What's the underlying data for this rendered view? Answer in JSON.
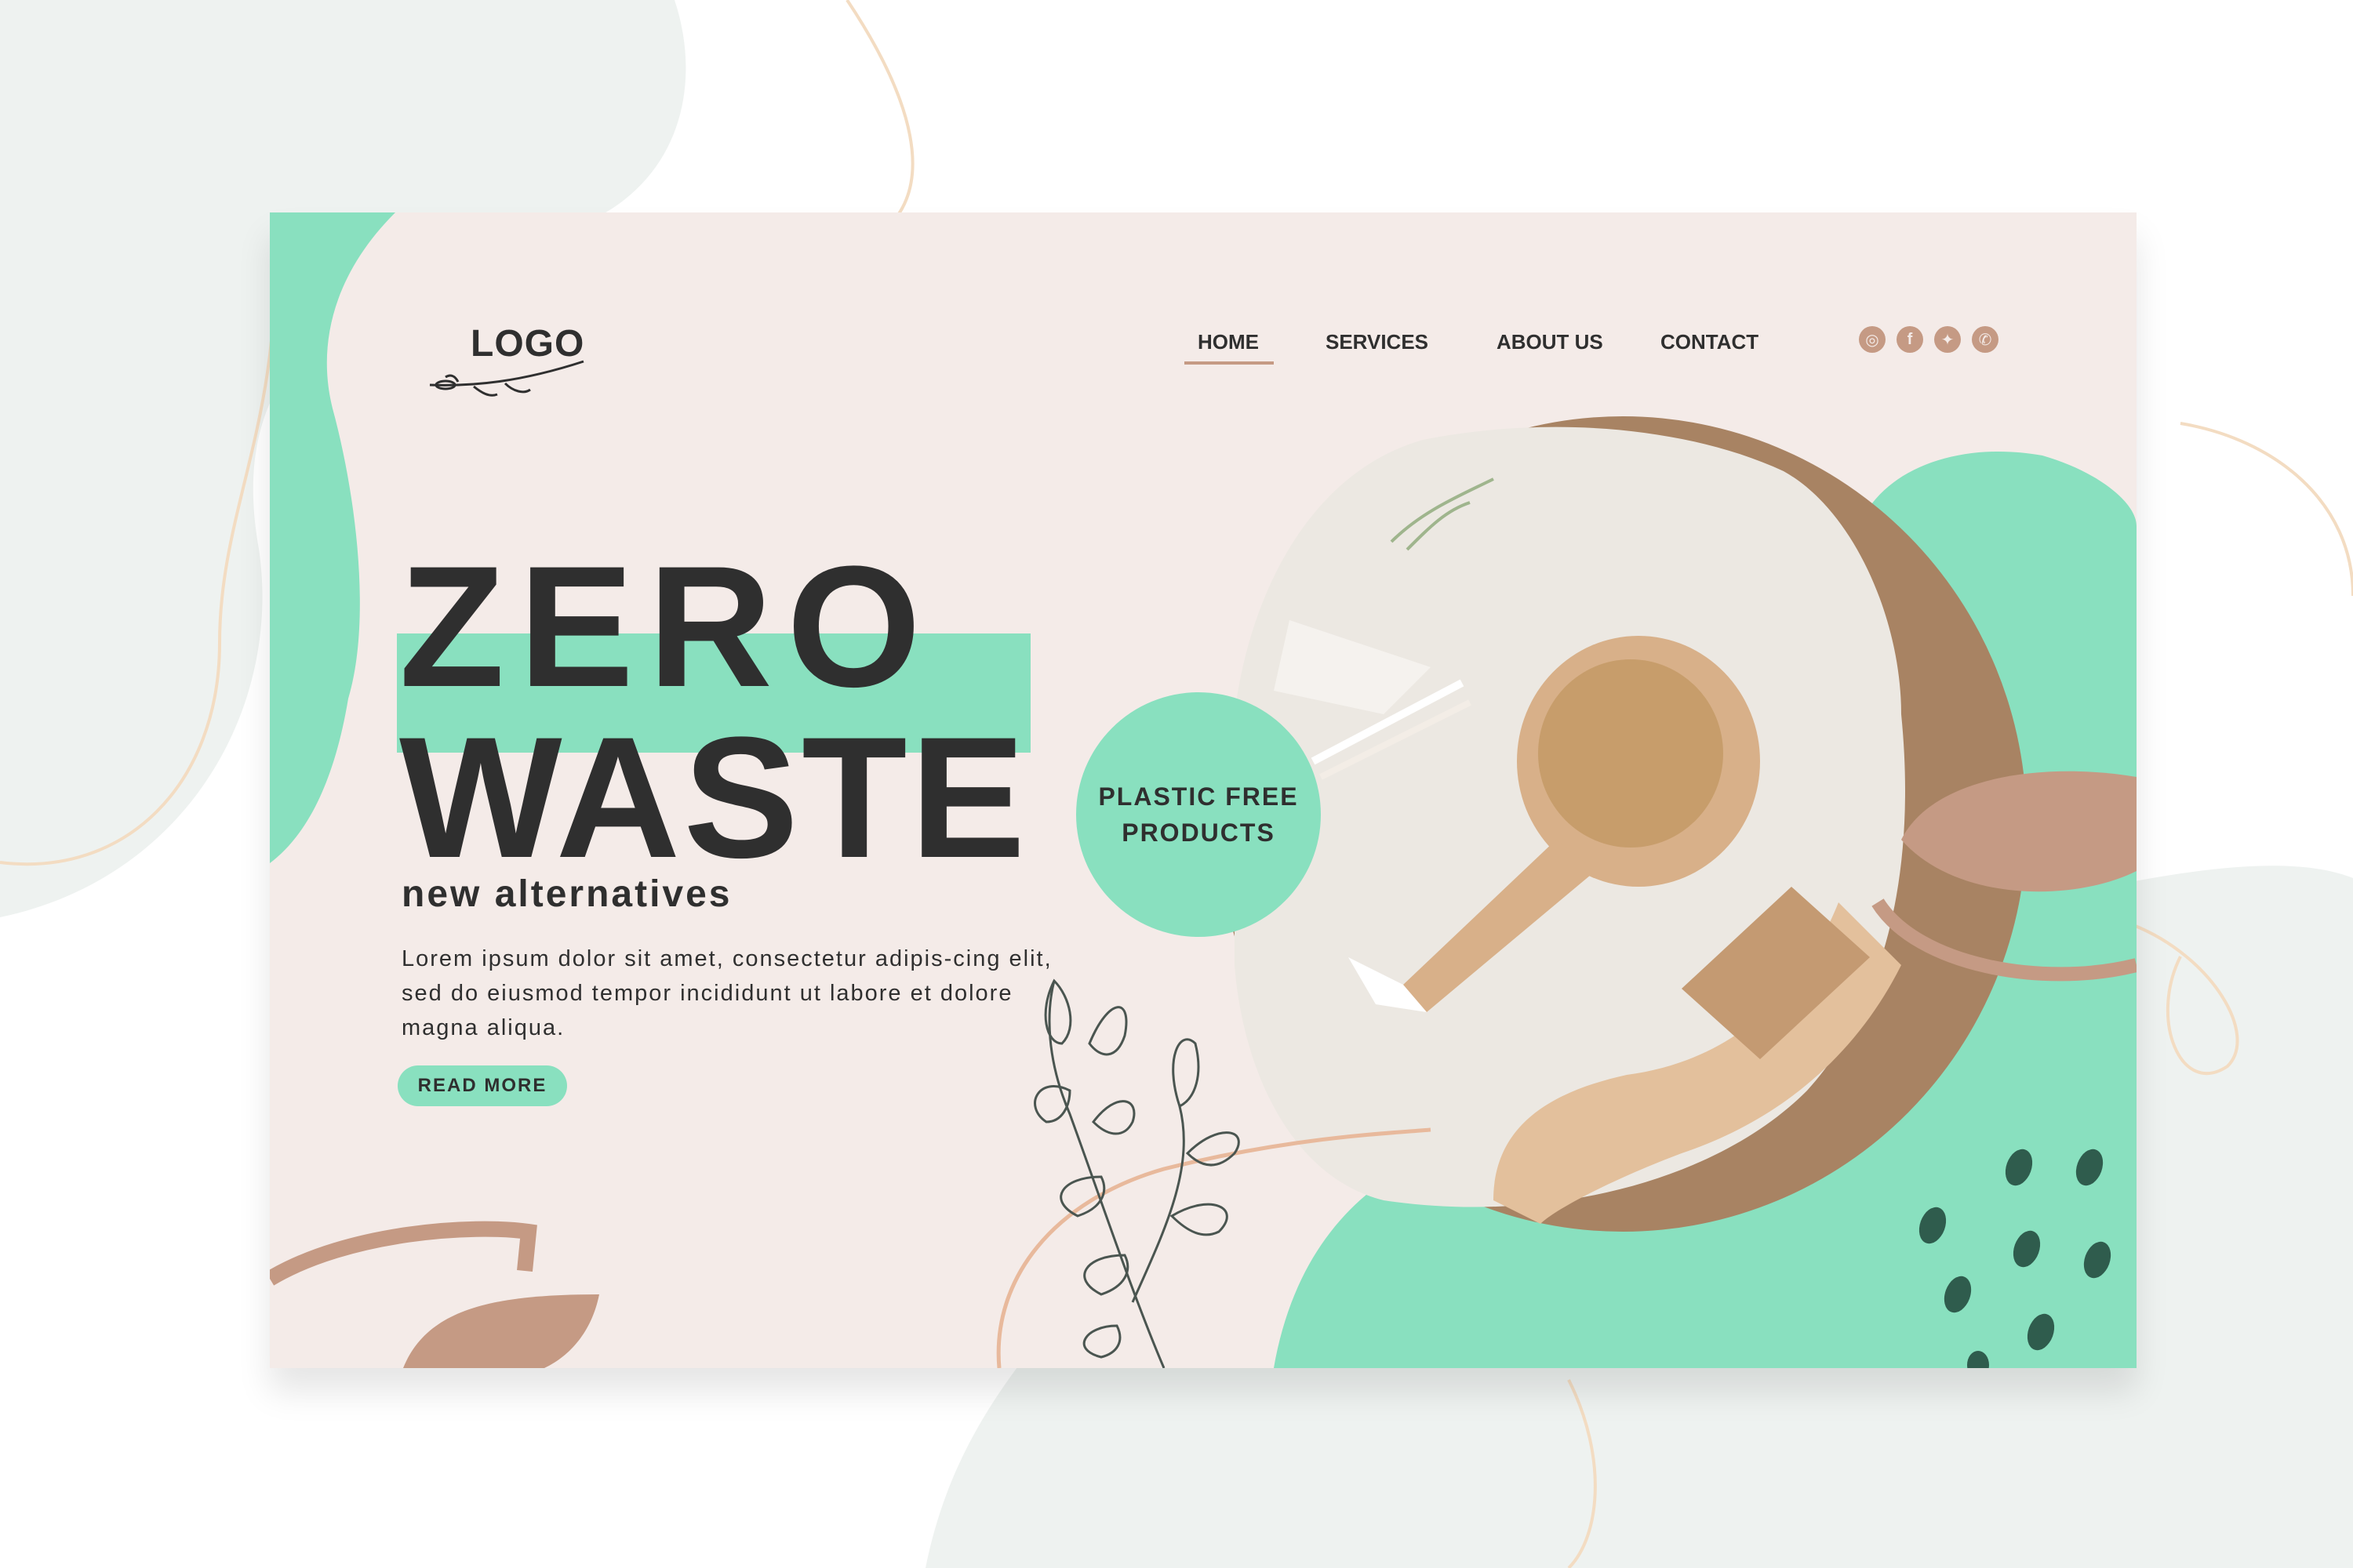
{
  "logo": {
    "text": "LOGO"
  },
  "nav": {
    "items": [
      {
        "label": "HOME",
        "active": true
      },
      {
        "label": "SERVICES",
        "active": false
      },
      {
        "label": "ABOUT US",
        "active": false
      },
      {
        "label": "CONTACT",
        "active": false
      }
    ]
  },
  "social": [
    {
      "icon": "instagram-icon",
      "glyph": "◎"
    },
    {
      "icon": "facebook-icon",
      "glyph": "f"
    },
    {
      "icon": "twitter-icon",
      "glyph": "✦"
    },
    {
      "icon": "whatsapp-icon",
      "glyph": "✆"
    }
  ],
  "hero": {
    "title_line1": "ZERO",
    "title_line2": "WASTE",
    "subtitle": "new alternatives",
    "body": "Lorem ipsum dolor sit amet, consectetur adipis-cing elit, sed do eiusmod tempor incididunt ut labore et dolore magna aliqua.",
    "button_label": "READ MORE"
  },
  "badge": {
    "text": "PLASTIC FREE PRODUCTS"
  },
  "photo": {
    "subject": "wooden-brush-and-comb"
  },
  "colors": {
    "mint": "#89e0bf",
    "background": "#f4ebe8",
    "accent": "#c59a84",
    "text": "#2f2f2f"
  }
}
